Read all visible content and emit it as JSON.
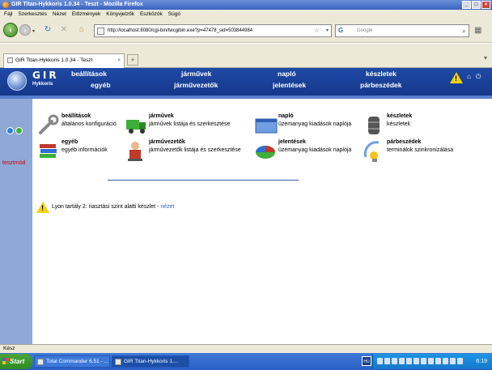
{
  "window": {
    "title": "GIR Titan-Hykkoris 1.0.34 - Teszt - Mozilla Firefox"
  },
  "menu": [
    "Fájl",
    "Szerkesztés",
    "Nézet",
    "Előzmények",
    "Könyvjelzők",
    "Eszközök",
    "Súgó"
  ],
  "url": "http://localhost:8080/cgi-bin/twcgibin.exe?p=47478_sid=503844984",
  "search_placeholder": "Google",
  "tab": {
    "title": "GIR Titan-Hykkoris 1.0.34 - Teszt"
  },
  "logo": {
    "brand": "GIR",
    "sub": "Hykkoris"
  },
  "nav": {
    "top": [
      "beállítások",
      "járművek",
      "napló",
      "készletek"
    ],
    "bottom": [
      "egyéb",
      "járművezetők",
      "jelentések",
      "párbeszédek"
    ]
  },
  "sidebar": {
    "mode": "tesztmód"
  },
  "items": [
    {
      "title": "beállítások",
      "desc": "általános konfiguráció",
      "icon": "wrench-icon"
    },
    {
      "title": "járművek",
      "desc": "járművek listája és szerkesztése",
      "icon": "truck-icon"
    },
    {
      "title": "napló",
      "desc": "üzemanyag kiadások naplója",
      "icon": "window-icon"
    },
    {
      "title": "készletek",
      "desc": "készletek",
      "icon": "tank-icon"
    },
    {
      "title": "egyéb",
      "desc": "egyéb információk",
      "icon": "books-icon"
    },
    {
      "title": "járművezetők",
      "desc": "járművezetők listája és szerkesztése",
      "icon": "driver-icon"
    },
    {
      "title": "jelentések",
      "desc": "üzemanyag kiadások naplója",
      "icon": "pie-chart-icon"
    },
    {
      "title": "párbeszédek",
      "desc": "terminálok szinkronizálása",
      "icon": "satellite-dish-icon"
    }
  ],
  "alert": {
    "message": "Lyon tartály 2: riasztási szint alatti készlet - ",
    "link": "nézet"
  },
  "status": "Kész",
  "taskbar": {
    "start": "Start",
    "items": [
      "Total Commander 6.51 - ...",
      "GIR Titan-Hykkoris 1...."
    ],
    "lang": "HU",
    "clock": "6:19"
  },
  "colors": {
    "header": "#1f4aa6",
    "sidebar": "#8fa8d6",
    "warning": "#f5d20d",
    "mode_text": "#cc0000"
  }
}
